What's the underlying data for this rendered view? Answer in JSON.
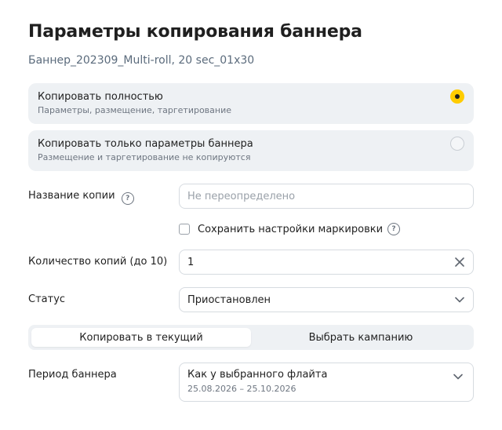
{
  "title": "Параметры копирования баннера",
  "banner_name": "Баннер_202309_Multi-roll, 20 sec_01x30",
  "options": [
    {
      "title": "Копировать полностью",
      "description": "Параметры, размещение, таргетирование",
      "selected": true
    },
    {
      "title": "Копировать только параметры баннера",
      "description": "Размещение и таргетирование не копируются",
      "selected": false
    }
  ],
  "copy_name": {
    "label": "Название копии",
    "placeholder": "Не переопределено",
    "value": ""
  },
  "help_glyph": "?",
  "marking_checkbox": {
    "label": "Сохранить настройки маркировки",
    "checked": false
  },
  "copies_count": {
    "label": "Количество копий (до 10)",
    "value": "1"
  },
  "status": {
    "label": "Статус",
    "value": "Приостановлен"
  },
  "target_switch": {
    "options": [
      "Копировать в текущий",
      "Выбрать кампанию"
    ],
    "active_index": 0
  },
  "period": {
    "label": "Период баннера",
    "value": "Как у выбранного флайта",
    "dates": "25.08.2026 – 25.10.2026"
  },
  "colors": {
    "accent": "#ffcc00",
    "option_bg": "#eef1f4",
    "border": "#d6dbe0",
    "muted_text": "#6e7681",
    "subtitle_text": "#5b6b7c"
  }
}
